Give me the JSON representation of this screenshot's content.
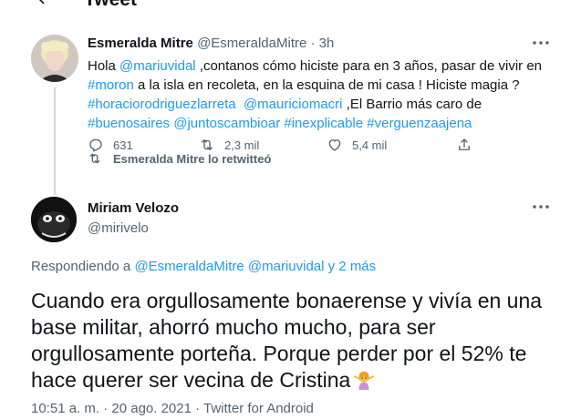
{
  "header": {
    "title": "Tweet"
  },
  "tweet1": {
    "name": "Esmeralda Mitre",
    "handle": "@EsmeraldaMitre",
    "dot": "·",
    "time": "3h",
    "text": {
      "p1": "Hola ",
      "m1": "@mariuvidal",
      "p2": " ,contanos cómo hiciste para en 3 años, pasar de vivir en ",
      "h1": "#moron",
      "p3": " a la isla en recoleta, en la esquina de mi casa ! Hiciste magia ?",
      "h2": "#horaciorodriguezlarreta",
      "p4": "  ",
      "m2": "@mauriciomacri",
      "p5": " ,El Barrio más caro de ",
      "h3": "#buenosaires",
      "p6": " ",
      "m3": "@juntoscambioar",
      "p7": " ",
      "h4": "#inexplicable",
      "p8": " ",
      "h5": "#verguenzaajena"
    },
    "actions": {
      "replies": "631",
      "retweets": "2,3 mil",
      "likes": "5,4 mil"
    }
  },
  "retweet_note": "Esmeralda Mitre lo retwitteó",
  "tweet2": {
    "name": "Miriam Velozo",
    "handle": "@mirivelo",
    "reply": {
      "prefix": "Respondiendo a ",
      "to1": "@EsmeraldaMitre",
      "space": " ",
      "to2": "@mariuvidal",
      "suffix": " y 2 más"
    },
    "text": "Cuando era orgullosamente bonaerense y vivía en una base militar, ahorró mucho mucho, para ser orgullosamente porteña. Porque perder por el 52% te hace querer ser vecina de Cristina",
    "emoji": "woman-shrugging-emoji",
    "meta": "10:51 a. m. · 20 ago. 2021 · Twitter for Android"
  },
  "colors": {
    "link": "#1d9bf0",
    "secondary": "#536471",
    "text": "#0f1419",
    "thread": "#cfd9de"
  }
}
